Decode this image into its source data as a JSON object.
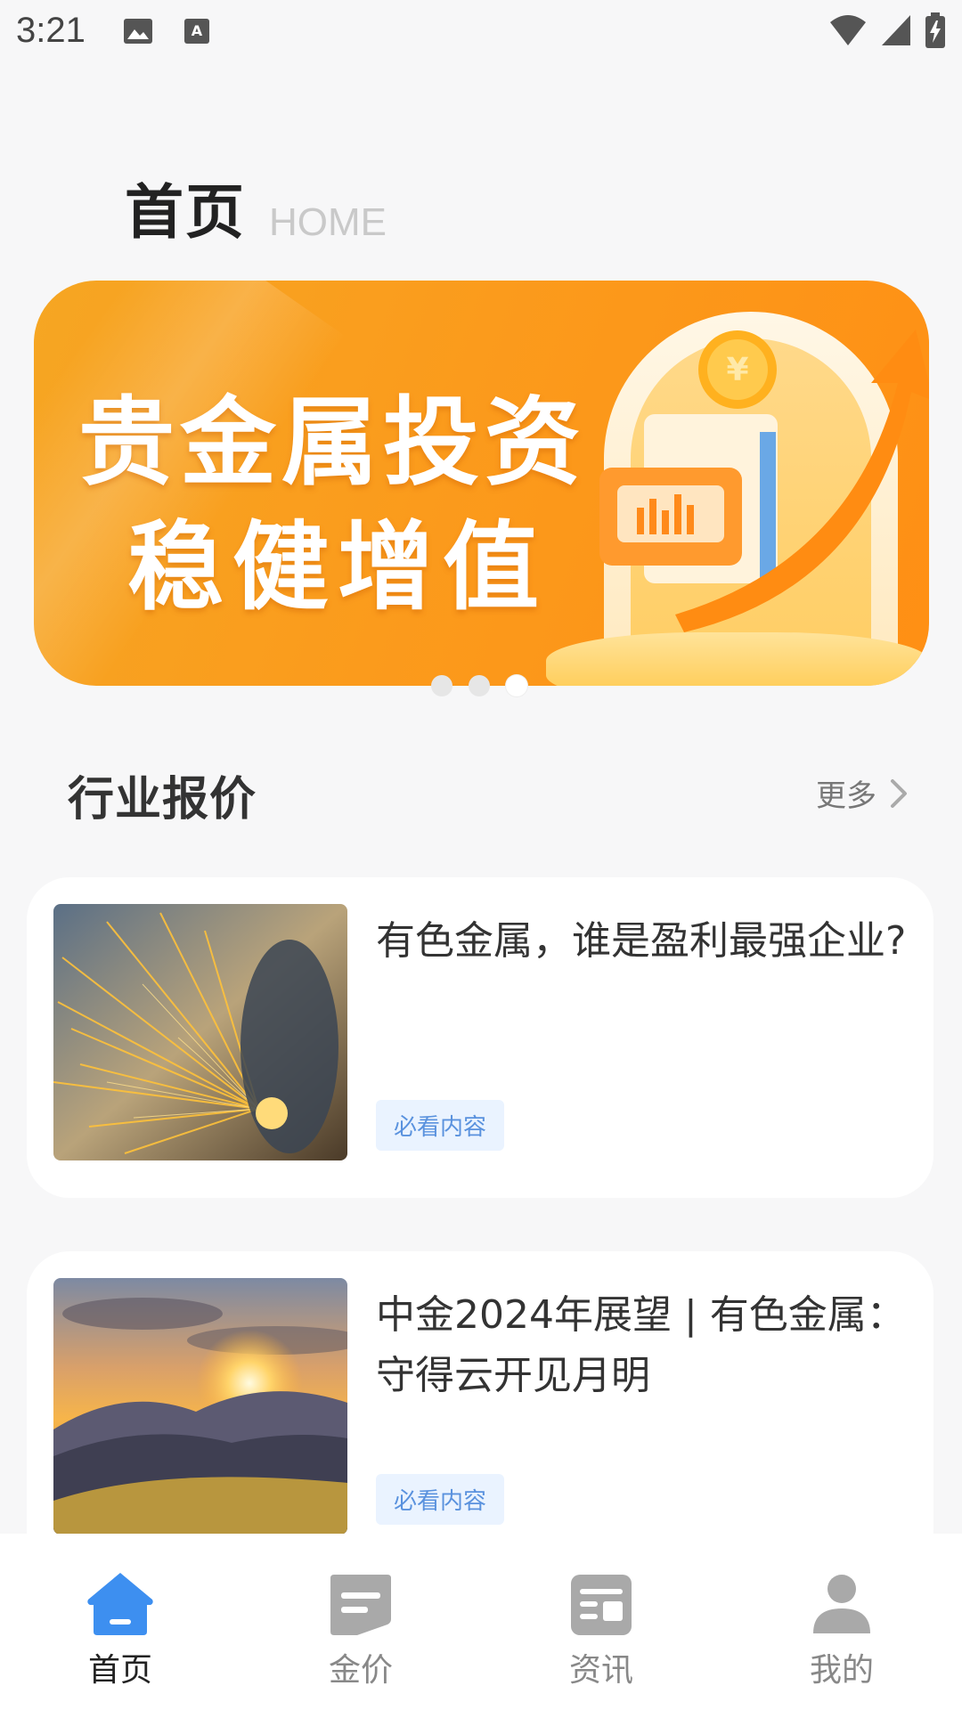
{
  "status_bar": {
    "time": "3:21"
  },
  "header": {
    "title": "首页",
    "subtitle": "HOME"
  },
  "banner": {
    "line1": "贵金属投资",
    "line2": "稳健增值",
    "slide_count": 3,
    "active_slide": 3
  },
  "section": {
    "title": "行业报价",
    "more_label": "更多"
  },
  "articles": [
    {
      "title": "有色金属，谁是盈利最强企业?",
      "tag": "必看内容"
    },
    {
      "title": "中金2024年展望 | 有色金属：守得云开见月明",
      "tag": "必看内容"
    }
  ],
  "tabs": [
    {
      "label": "首页",
      "icon": "home-icon",
      "active": true
    },
    {
      "label": "金价",
      "icon": "price-icon",
      "active": false
    },
    {
      "label": "资讯",
      "icon": "news-icon",
      "active": false
    },
    {
      "label": "我的",
      "icon": "user-icon",
      "active": false
    }
  ],
  "colors": {
    "accent": "#3d8ff0",
    "banner": "#fb9b1c",
    "tag_text": "#5a92de",
    "tag_bg": "#eaf3ff"
  }
}
